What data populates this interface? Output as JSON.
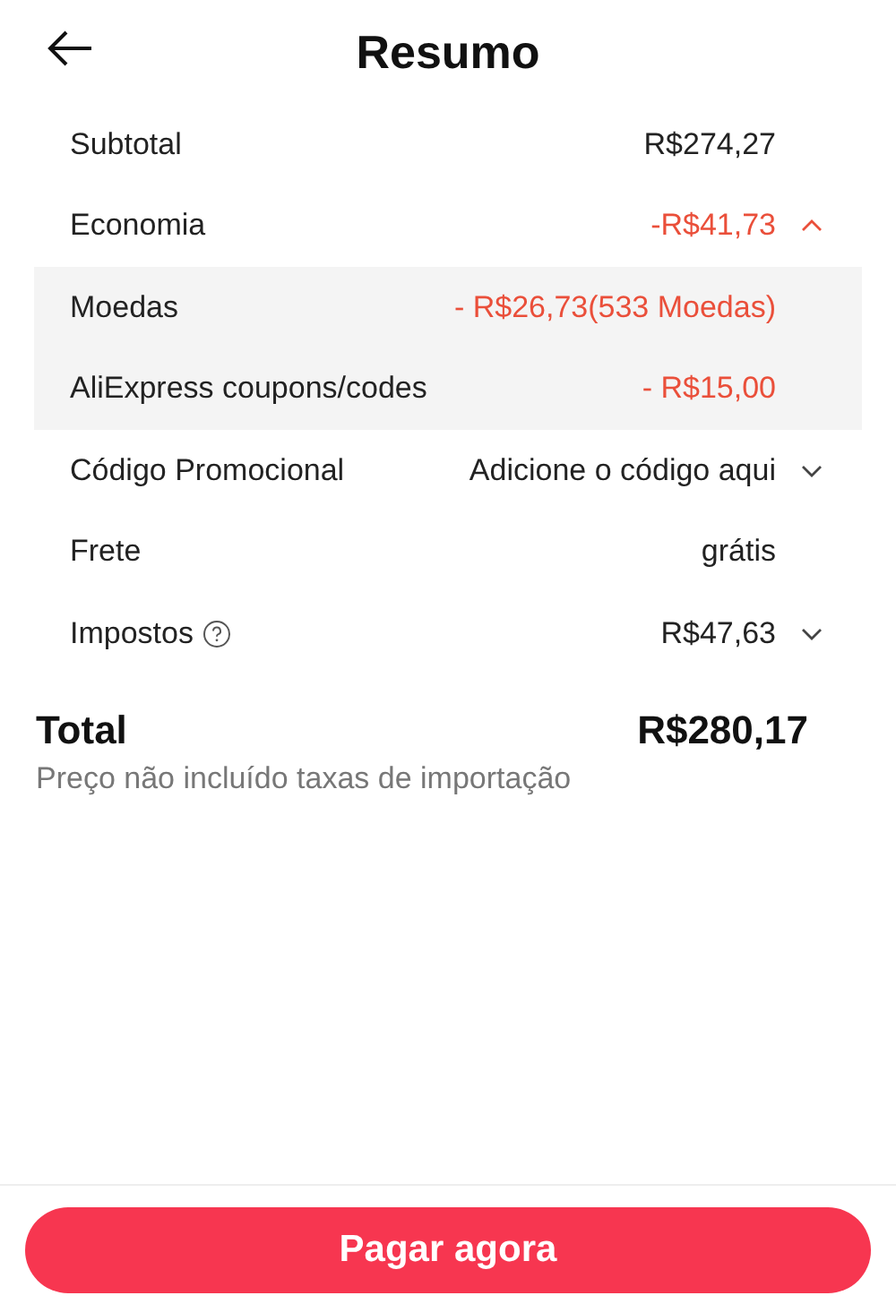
{
  "header": {
    "title": "Resumo"
  },
  "rows": [
    {
      "label": "Subtotal",
      "value": "R$274,27",
      "kind": "normal"
    },
    {
      "label": "Economia",
      "value": "-R$41,73",
      "kind": "discount",
      "expanded": true,
      "children": [
        {
          "label": "Moedas",
          "value": "- R$26,73(533 Moedas)",
          "kind": "discount"
        },
        {
          "label": "AliExpress coupons/codes",
          "value": "- R$15,00",
          "kind": "discount"
        }
      ]
    },
    {
      "label": "Código Promocional",
      "value": "Adicione o código aqui",
      "kind": "normal",
      "expanded": false
    },
    {
      "label": "Frete",
      "value": "grátis",
      "kind": "normal"
    },
    {
      "label": "Impostos",
      "value": "R$47,63",
      "kind": "normal",
      "help": true,
      "expanded": false
    }
  ],
  "total": {
    "label": "Total",
    "value": "R$280,17",
    "note": "Preço não incluído taxas de importação"
  },
  "button": {
    "label": "Pagar agora"
  }
}
